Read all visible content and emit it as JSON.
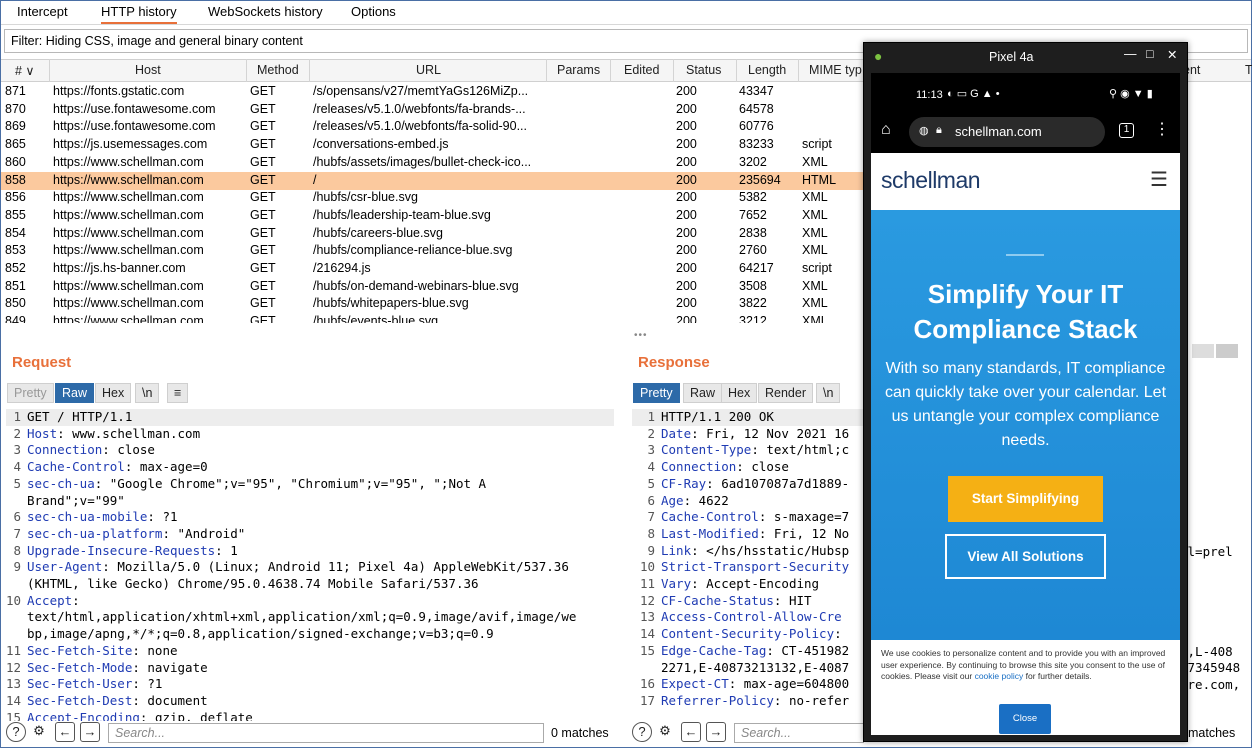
{
  "tabs": [
    "Intercept",
    "HTTP history",
    "WebSockets history",
    "Options"
  ],
  "filter": "Filter: Hiding CSS, image and general binary content",
  "columns": [
    "# ∨",
    "Host",
    "Method",
    "URL",
    "Params",
    "Edited",
    "Status",
    "Length",
    "MIME typ",
    "ent",
    "T"
  ],
  "rows": [
    {
      "n": "871",
      "host": "https://fonts.gstatic.com",
      "method": "GET",
      "url": "/s/opensans/v27/memtYaGs126MiZp...",
      "status": "200",
      "length": "43347",
      "mime": ""
    },
    {
      "n": "870",
      "host": "https://use.fontawesome.com",
      "method": "GET",
      "url": "/releases/v5.1.0/webfonts/fa-brands-...",
      "status": "200",
      "length": "64578",
      "mime": ""
    },
    {
      "n": "869",
      "host": "https://use.fontawesome.com",
      "method": "GET",
      "url": "/releases/v5.1.0/webfonts/fa-solid-90...",
      "status": "200",
      "length": "60776",
      "mime": ""
    },
    {
      "n": "865",
      "host": "https://js.usemessages.com",
      "method": "GET",
      "url": "/conversations-embed.js",
      "status": "200",
      "length": "83233",
      "mime": "script"
    },
    {
      "n": "860",
      "host": "https://www.schellman.com",
      "method": "GET",
      "url": "/hubfs/assets/images/bullet-check-ico...",
      "status": "200",
      "length": "3202",
      "mime": "XML"
    },
    {
      "n": "858",
      "host": "https://www.schellman.com",
      "method": "GET",
      "url": "/",
      "status": "200",
      "length": "235694",
      "mime": "HTML"
    },
    {
      "n": "856",
      "host": "https://www.schellman.com",
      "method": "GET",
      "url": "/hubfs/csr-blue.svg",
      "status": "200",
      "length": "5382",
      "mime": "XML"
    },
    {
      "n": "855",
      "host": "https://www.schellman.com",
      "method": "GET",
      "url": "/hubfs/leadership-team-blue.svg",
      "status": "200",
      "length": "7652",
      "mime": "XML"
    },
    {
      "n": "854",
      "host": "https://www.schellman.com",
      "method": "GET",
      "url": "/hubfs/careers-blue.svg",
      "status": "200",
      "length": "2838",
      "mime": "XML"
    },
    {
      "n": "853",
      "host": "https://www.schellman.com",
      "method": "GET",
      "url": "/hubfs/compliance-reliance-blue.svg",
      "status": "200",
      "length": "2760",
      "mime": "XML"
    },
    {
      "n": "852",
      "host": "https://js.hs-banner.com",
      "method": "GET",
      "url": "/216294.js",
      "status": "200",
      "length": "64217",
      "mime": "script"
    },
    {
      "n": "851",
      "host": "https://www.schellman.com",
      "method": "GET",
      "url": "/hubfs/on-demand-webinars-blue.svg",
      "status": "200",
      "length": "3508",
      "mime": "XML"
    },
    {
      "n": "850",
      "host": "https://www.schellman.com",
      "method": "GET",
      "url": "/hubfs/whitepapers-blue.svg",
      "status": "200",
      "length": "3822",
      "mime": "XML"
    },
    {
      "n": "849",
      "host": "https://www.schellman.com",
      "method": "GET",
      "url": "/hubfs/events-blue.svg",
      "status": "200",
      "length": "3212",
      "mime": "XML"
    }
  ],
  "selected_row": "858",
  "request": {
    "title": "Request",
    "views": [
      "Pretty",
      "Raw",
      "Hex",
      "\\n",
      "≡"
    ],
    "active_view": "Raw",
    "lines": [
      {
        "n": "1",
        "k": "",
        "v": "GET / HTTP/1.1"
      },
      {
        "n": "2",
        "k": "Host",
        "v": ": www.schellman.com"
      },
      {
        "n": "3",
        "k": "Connection",
        "v": ": close"
      },
      {
        "n": "4",
        "k": "Cache-Control",
        "v": ": max-age=0"
      },
      {
        "n": "5",
        "k": "sec-ch-ua",
        "v": ": \"Google Chrome\";v=\"95\", \"Chromium\";v=\"95\", \";Not A"
      },
      {
        "n": "",
        "k": "",
        "v": "Brand\";v=\"99\""
      },
      {
        "n": "6",
        "k": "sec-ch-ua-mobile",
        "v": ": ?1"
      },
      {
        "n": "7",
        "k": "sec-ch-ua-platform",
        "v": ": \"Android\""
      },
      {
        "n": "8",
        "k": "Upgrade-Insecure-Requests",
        "v": ": 1"
      },
      {
        "n": "9",
        "k": "User-Agent",
        "v": ": Mozilla/5.0 (Linux; Android 11; Pixel 4a) AppleWebKit/537.36"
      },
      {
        "n": "",
        "k": "",
        "v": "(KHTML, like Gecko) Chrome/95.0.4638.74 Mobile Safari/537.36"
      },
      {
        "n": "10",
        "k": "Accept",
        "v": ":"
      },
      {
        "n": "",
        "k": "",
        "v": "text/html,application/xhtml+xml,application/xml;q=0.9,image/avif,image/we"
      },
      {
        "n": "",
        "k": "",
        "v": "bp,image/apng,*/*;q=0.8,application/signed-exchange;v=b3;q=0.9"
      },
      {
        "n": "11",
        "k": "Sec-Fetch-Site",
        "v": ": none"
      },
      {
        "n": "12",
        "k": "Sec-Fetch-Mode",
        "v": ": navigate"
      },
      {
        "n": "13",
        "k": "Sec-Fetch-User",
        "v": ": ?1"
      },
      {
        "n": "14",
        "k": "Sec-Fetch-Dest",
        "v": ": document"
      },
      {
        "n": "15",
        "k": "Accept-Encoding",
        "v": ": gzip, deflate"
      }
    ]
  },
  "response": {
    "title": "Response",
    "views": [
      "Pretty",
      "Raw",
      "Hex",
      "Render",
      "\\n"
    ],
    "active_view": "Pretty",
    "lines": [
      {
        "n": "1",
        "k": "",
        "v": "HTTP/1.1 200 OK"
      },
      {
        "n": "2",
        "k": "Date",
        "v": ": Fri, 12 Nov 2021 16"
      },
      {
        "n": "3",
        "k": "Content-Type",
        "v": ": text/html;c"
      },
      {
        "n": "4",
        "k": "Connection",
        "v": ": close"
      },
      {
        "n": "5",
        "k": "CF-Ray",
        "v": ": 6ad107087a7d1889-"
      },
      {
        "n": "6",
        "k": "Age",
        "v": ": 4622"
      },
      {
        "n": "7",
        "k": "Cache-Control",
        "v": ": s-maxage=7"
      },
      {
        "n": "8",
        "k": "Last-Modified",
        "v": ": Fri, 12 No"
      },
      {
        "n": "9",
        "k": "Link",
        "v": ": </hs/hsstatic/Hubsp"
      },
      {
        "n": "10",
        "k": "Strict-Transport-Security",
        "v": ""
      },
      {
        "n": "11",
        "k": "Vary",
        "v": ": Accept-Encoding"
      },
      {
        "n": "12",
        "k": "CF-Cache-Status",
        "v": ": HIT"
      },
      {
        "n": "13",
        "k": "Access-Control-Allow-Cre",
        "v": ""
      },
      {
        "n": "14",
        "k": "Content-Security-Policy",
        "v": ":"
      },
      {
        "n": "15",
        "k": "Edge-Cache-Tag",
        "v": ": CT-451982"
      },
      {
        "n": "",
        "k": "",
        "v": "2271,E-40873213132,E-4087"
      },
      {
        "n": "16",
        "k": "Expect-CT",
        "v": ": max-age=604800"
      },
      {
        "n": "17",
        "k": "Referrer-Policy",
        "v": ": no-refer"
      }
    ],
    "overflow_right": [
      "el=prel",
      "7,L-408",
      "87345948",
      "are.com,"
    ]
  },
  "bottom": {
    "search_placeholder": "Search...",
    "left_matches": "0 matches",
    "right_matches": "matches"
  },
  "phone": {
    "title": "Pixel 4a",
    "time": "11:13",
    "url": "schellman.com",
    "tab_count": "1",
    "logo": "schellman",
    "hero_heading_1": "Simplify Your IT",
    "hero_heading_2": "Compliance Stack",
    "hero_text_1": "With so many standards, IT compliance",
    "hero_text_2": "can quickly take over your calendar. Let",
    "hero_text_3": "us untangle your complex compliance",
    "hero_text_4": "needs.",
    "btn_primary": "Start Simplifying",
    "btn_secondary": "View All Solutions",
    "cookie_text": "We use cookies to personalize content and to provide you with an improved user experience. By continuing to browse this site you consent to the use of cookies. Please visit our",
    "cookie_link": "cookie policy",
    "cookie_tail": "for further details.",
    "cookie_btn": "Close"
  },
  "colors": {
    "accent": "#e8703a",
    "selected_row": "#fbc99e",
    "key_blue": "#1f3bb3",
    "hero_blue": "#2a9ae0",
    "cta_yellow": "#f5b014"
  }
}
